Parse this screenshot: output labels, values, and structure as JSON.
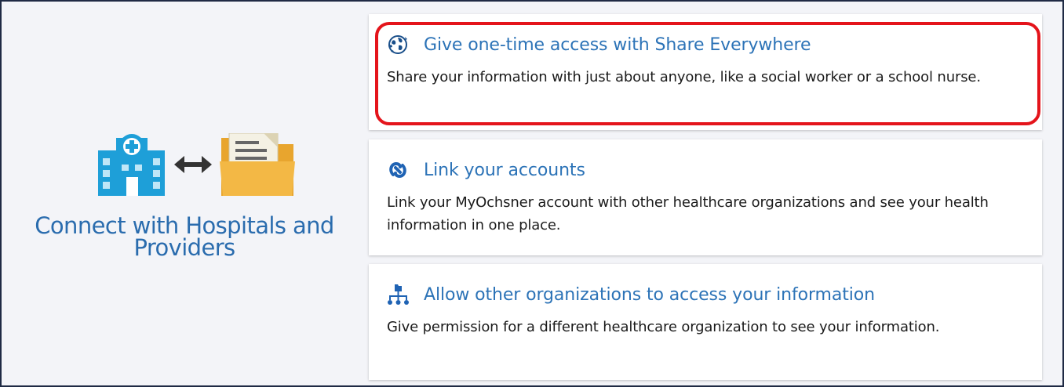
{
  "hero": {
    "title_line1": "Connect with Hospitals and",
    "title_line2": "Providers",
    "icons": [
      "hospital-icon",
      "double-arrow-icon",
      "folder-document-icon"
    ]
  },
  "options": [
    {
      "icon": "globe-icon",
      "title": "Give one-time access with Share Everywhere",
      "description": "Share your information with just about anyone, like a social worker or a school nurse.",
      "highlighted": true
    },
    {
      "icon": "link-icon",
      "title": "Link your accounts",
      "description": "Link your MyOchsner account with other healthcare organizations and see your health information in one place."
    },
    {
      "icon": "org-chart-icon",
      "title": "Allow other organizations to access your information",
      "description": "Give permission for a different healthcare organization to see your information."
    }
  ],
  "colors": {
    "accent": "#2c73b7",
    "highlight": "#e4141b",
    "panel_bg": "#f3f4f8",
    "hospital_blue": "#1e9fd8",
    "folder_yellow": "#f2b33d"
  }
}
